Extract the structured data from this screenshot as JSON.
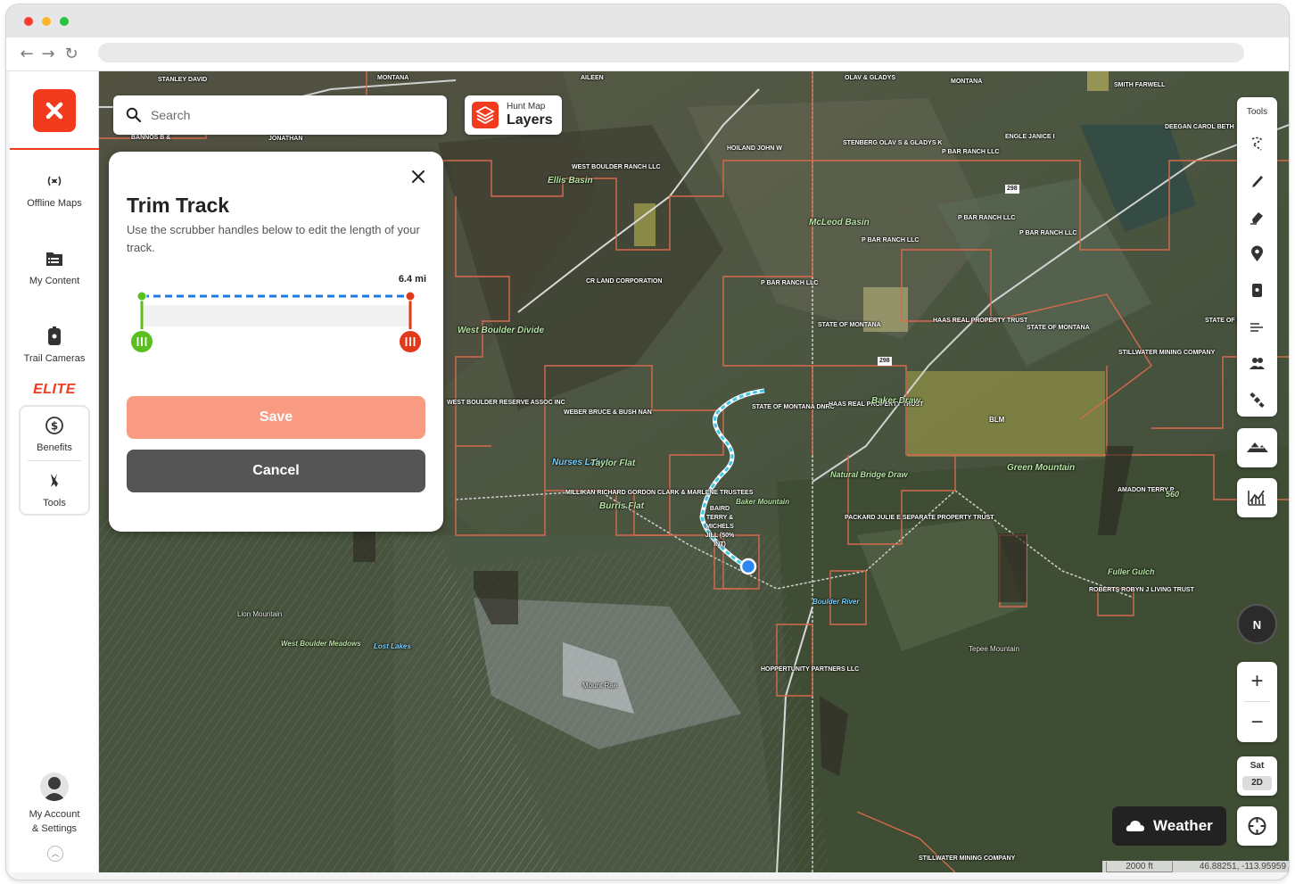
{
  "sidebar": {
    "items": [
      {
        "label": "Offline Maps",
        "icon": "offline-maps-icon"
      },
      {
        "label": "My Content",
        "icon": "folder-icon"
      },
      {
        "label": "Trail Cameras",
        "icon": "trail-camera-icon"
      }
    ],
    "elite_label": "ELITE",
    "elite_items": [
      {
        "label": "Benefits",
        "icon": "dollar-icon"
      },
      {
        "label": "Tools",
        "icon": "tools-icon"
      }
    ],
    "account_line1": "My Account",
    "account_line2": "& Settings"
  },
  "search": {
    "placeholder": "Search"
  },
  "layers": {
    "line1": "Hunt Map",
    "line2": "Layers"
  },
  "trim_panel": {
    "title": "Trim Track",
    "description": "Use the scrubber handles below to edit the length of your track.",
    "distance": "6.4 mi",
    "track_fraction_start": 0,
    "track_fraction_end": 1,
    "save_label": "Save",
    "cancel_label": "Cancel",
    "start_color": "#5bbf1f",
    "end_color": "#e03a1a",
    "track_color": "#1c7ae0"
  },
  "tools": {
    "title": "Tools",
    "icons": [
      "lasso-icon",
      "pen-icon",
      "eraser-icon",
      "pin-icon",
      "trail-camera-icon",
      "wind-icon",
      "people-icon",
      "satellite-icon"
    ]
  },
  "controls": {
    "compass_label": "N",
    "zoom_in": "+",
    "zoom_out": "−",
    "sat_label": "Sat",
    "mode_label": "2D",
    "weather_label": "Weather"
  },
  "scale": {
    "distance": "2000 ft",
    "coords": "46.88251, -113.95959"
  },
  "map_labels": [
    "STANLEY DAVID",
    "MONTANA",
    "AILEEN",
    "OLAV & GLADYS",
    "MONTANA",
    "SMITH FARWELL",
    "DEEGAN CAROL BETH",
    "BANNOS B &",
    "JONATHAN",
    "HOILAND JOHN W",
    "STENBERG OLAV S & GLADYS K",
    "P BAR RANCH LLC",
    "ENGLE JANICE I",
    "WEST BOULDER RANCH LLC",
    "Ellis Basin",
    "McLeod Basin",
    "P BAR RANCH LLC",
    "P BAR RANCH LLC",
    "P BAR RANCH LLC",
    "CR LAND CORPORATION",
    "P BAR RANCH LLC",
    "STATE OF MONTANA",
    "HAAS REAL PROPERTY TRUST",
    "STATE OF MONTANA",
    "STATE OF MONTANA",
    "STILLWATER MINING COMPANY",
    "West Boulder Divide",
    "WEST BOULDER RESERVE ASSOC INC",
    "WEBER BRUCE & BUSH NAN",
    "STATE OF MONTANA DNRC",
    "HAAS REAL PROPERTY TRUST",
    "Baker Draw",
    "BLM",
    "Green Mountain",
    "AMADON TERRY P",
    "560",
    "Nurses Lakes",
    "Taylor Flat",
    "Burris Flat",
    "MILLIKAN RICHARD GORDON CLARK & MARLENE TRUSTEES",
    "BAIRD TERRY & MICHELS JILL (50% INT)",
    "Baker Mountain",
    "PACKARD JULIE E SEPARATE PROPERTY TRUST",
    "Natural Bridge Draw",
    "ROBERTS ROBYN J LIVING TRUST",
    "Fuller Gulch",
    "Lion Mountain",
    "West Boulder Meadows",
    "Lost Lakes",
    "Mount Rae",
    "HOPPERTUNITY PARTNERS LLC",
    "Tepee Mountain",
    "Boulder River",
    "STILLWATER MINING COMPANY",
    "298",
    "298"
  ]
}
